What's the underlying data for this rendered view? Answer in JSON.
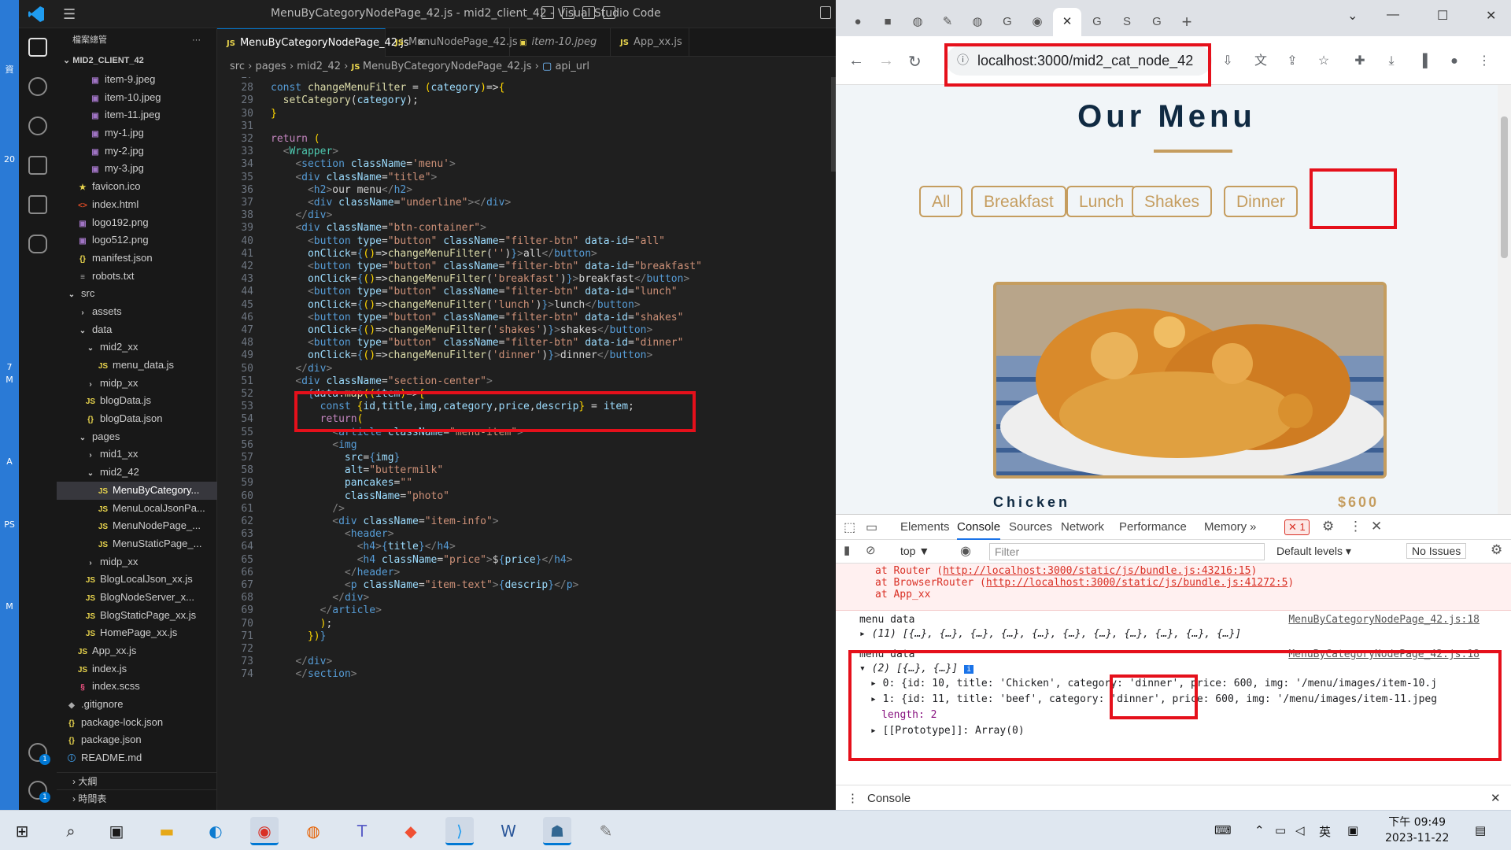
{
  "desktop": {
    "labels": [
      "資",
      "20",
      "7",
      "M",
      "A",
      "PS",
      "M"
    ]
  },
  "vscode": {
    "window_title": "MenuByCategoryNodePage_42.js - mid2_client_42 - Visual Studio Code",
    "explorer_header": "檔案總管",
    "project": "MID2_CLIENT_42",
    "badges": {
      "accounts": "1",
      "settings": "1"
    },
    "tree": [
      {
        "label": "item-9.jpeg",
        "icon": "img",
        "indent": 40
      },
      {
        "label": "item-10.jpeg",
        "icon": "img",
        "indent": 40
      },
      {
        "label": "item-11.jpeg",
        "icon": "img",
        "indent": 40
      },
      {
        "label": "my-1.jpg",
        "icon": "img",
        "indent": 40
      },
      {
        "label": "my-2.jpg",
        "icon": "img",
        "indent": 40
      },
      {
        "label": "my-3.jpg",
        "icon": "img",
        "indent": 40
      },
      {
        "label": "favicon.ico",
        "icon": "ico",
        "indent": 24
      },
      {
        "label": "index.html",
        "icon": "html",
        "indent": 24
      },
      {
        "label": "logo192.png",
        "icon": "img",
        "indent": 24
      },
      {
        "label": "logo512.png",
        "icon": "img",
        "indent": 24
      },
      {
        "label": "manifest.json",
        "icon": "json",
        "indent": 24
      },
      {
        "label": "robots.txt",
        "icon": "txt",
        "indent": 24
      },
      {
        "label": "src",
        "icon": "fold-open",
        "indent": 10
      },
      {
        "label": "assets",
        "icon": "fold",
        "indent": 24
      },
      {
        "label": "data",
        "icon": "fold-open",
        "indent": 24
      },
      {
        "label": "mid2_xx",
        "icon": "fold-open",
        "indent": 34
      },
      {
        "label": "menu_data.js",
        "icon": "js",
        "indent": 50
      },
      {
        "label": "midp_xx",
        "icon": "fold",
        "indent": 34
      },
      {
        "label": "blogData.js",
        "icon": "js",
        "indent": 34
      },
      {
        "label": "blogData.json",
        "icon": "json",
        "indent": 34
      },
      {
        "label": "pages",
        "icon": "fold-open",
        "indent": 24
      },
      {
        "label": "mid1_xx",
        "icon": "fold",
        "indent": 34
      },
      {
        "label": "mid2_42",
        "icon": "fold-open",
        "indent": 34
      },
      {
        "label": "MenuByCategory...",
        "icon": "js",
        "indent": 50,
        "selected": true
      },
      {
        "label": "MenuLocalJsonPa...",
        "icon": "js",
        "indent": 50
      },
      {
        "label": "MenuNodePage_...",
        "icon": "js",
        "indent": 50
      },
      {
        "label": "MenuStaticPage_...",
        "icon": "js",
        "indent": 50
      },
      {
        "label": "midp_xx",
        "icon": "fold",
        "indent": 34
      },
      {
        "label": "BlogLocalJson_xx.js",
        "icon": "js",
        "indent": 34
      },
      {
        "label": "BlogNodeServer_x...",
        "icon": "js",
        "indent": 34
      },
      {
        "label": "BlogStaticPage_xx.js",
        "icon": "js",
        "indent": 34
      },
      {
        "label": "HomePage_xx.js",
        "icon": "js",
        "indent": 34
      },
      {
        "label": "App_xx.js",
        "icon": "js",
        "indent": 24
      },
      {
        "label": "index.js",
        "icon": "js",
        "indent": 24
      },
      {
        "label": "index.scss",
        "icon": "css",
        "indent": 24
      },
      {
        "label": ".gitignore",
        "icon": "git",
        "indent": 10
      },
      {
        "label": "package-lock.json",
        "icon": "json",
        "indent": 10
      },
      {
        "label": "package.json",
        "icon": "json",
        "indent": 10
      },
      {
        "label": "README.md",
        "icon": "md",
        "indent": 10
      }
    ],
    "outline": "大綱",
    "timeline": "時間表",
    "tabs": [
      {
        "label": "MenuByCategoryNodePage_42.js",
        "active": true,
        "kind": "JS"
      },
      {
        "label": "MenuNodePage_42.js",
        "active": false,
        "kind": "JS"
      },
      {
        "label": "item-10.jpeg",
        "active": false,
        "kind": "img"
      },
      {
        "label": "App_xx.js",
        "active": false,
        "kind": "JS"
      }
    ],
    "breadcrumb": [
      "src",
      "pages",
      "mid2_42",
      "MenuByCategoryNodePage_42.js",
      "api_url"
    ],
    "code_lines": [
      {
        "n": "27",
        "html": ""
      },
      {
        "n": "28",
        "html": "<span class='k'>const</span> <span class='f'>changeMenuFilter</span> = <span class='br'>(</span><span class='a'>category</span><span class='br'>)</span>=><span class='br'>{</span>"
      },
      {
        "n": "29",
        "html": "  <span class='f'>setCategory</span>(<span class='a'>category</span>);"
      },
      {
        "n": "30",
        "html": "<span class='br'>}</span>"
      },
      {
        "n": "31",
        "html": ""
      },
      {
        "n": "32",
        "html": "<span class='kw'>return</span> <span class='br'>(</span>"
      },
      {
        "n": "33",
        "html": "  <span class='tg'>&lt;</span><span class='t'>Wrapper</span><span class='tg'>&gt;</span>"
      },
      {
        "n": "34",
        "html": "    <span class='tg'>&lt;</span><span class='tn'>section</span> <span class='a'>className</span>=<span class='s'>'menu'</span><span class='tg'>&gt;</span>"
      },
      {
        "n": "35",
        "html": "    <span class='tg'>&lt;</span><span class='tn'>div</span> <span class='a'>className</span>=<span class='s'>\"title\"</span><span class='tg'>&gt;</span>"
      },
      {
        "n": "36",
        "html": "      <span class='tg'>&lt;</span><span class='tn'>h2</span><span class='tg'>&gt;</span>our menu<span class='tg'>&lt;/</span><span class='tn'>h2</span><span class='tg'>&gt;</span>"
      },
      {
        "n": "37",
        "html": "      <span class='tg'>&lt;</span><span class='tn'>div</span> <span class='a'>className</span>=<span class='s'>\"underline\"</span><span class='tg'>&gt;&lt;/</span><span class='tn'>div</span><span class='tg'>&gt;</span>"
      },
      {
        "n": "38",
        "html": "    <span class='tg'>&lt;/</span><span class='tn'>div</span><span class='tg'>&gt;</span>"
      },
      {
        "n": "39",
        "html": "    <span class='tg'>&lt;</span><span class='tn'>div</span> <span class='a'>className</span>=<span class='s'>\"btn-container\"</span><span class='tg'>&gt;</span>"
      },
      {
        "n": "40",
        "html": "      <span class='tg'>&lt;</span><span class='tn'>button</span> <span class='a'>type</span>=<span class='s'>\"button\"</span> <span class='a'>className</span>=<span class='s'>\"filter-btn\"</span> <span class='a'>data-id</span>=<span class='s'>\"all\"</span>"
      },
      {
        "n": "41",
        "html": "      <span class='a'>onClick</span>=<span class='k'>{</span><span class='br'>()</span>=><span class='f'>changeMenuFilter</span>(<span class='s'>''</span>)<span class='k'>}</span><span class='tg'>&gt;</span>all<span class='tg'>&lt;/</span><span class='tn'>button</span><span class='tg'>&gt;</span>"
      },
      {
        "n": "42",
        "html": "      <span class='tg'>&lt;</span><span class='tn'>button</span> <span class='a'>type</span>=<span class='s'>\"button\"</span> <span class='a'>className</span>=<span class='s'>\"filter-btn\"</span> <span class='a'>data-id</span>=<span class='s'>\"breakfast\"</span>"
      },
      {
        "n": "43",
        "html": "      <span class='a'>onClick</span>=<span class='k'>{</span><span class='br'>()</span>=><span class='f'>changeMenuFilter</span>(<span class='s'>'breakfast'</span>)<span class='k'>}</span><span class='tg'>&gt;</span>breakfast<span class='tg'>&lt;/</span><span class='tn'>button</span><span class='tg'>&gt;</span>"
      },
      {
        "n": "44",
        "html": "      <span class='tg'>&lt;</span><span class='tn'>button</span> <span class='a'>type</span>=<span class='s'>\"button\"</span> <span class='a'>className</span>=<span class='s'>\"filter-btn\"</span> <span class='a'>data-id</span>=<span class='s'>\"lunch\"</span>"
      },
      {
        "n": "45",
        "html": "      <span class='a'>onClick</span>=<span class='k'>{</span><span class='br'>()</span>=><span class='f'>changeMenuFilter</span>(<span class='s'>'lunch'</span>)<span class='k'>}</span><span class='tg'>&gt;</span>lunch<span class='tg'>&lt;/</span><span class='tn'>button</span><span class='tg'>&gt;</span>"
      },
      {
        "n": "46",
        "html": "      <span class='tg'>&lt;</span><span class='tn'>button</span> <span class='a'>type</span>=<span class='s'>\"button\"</span> <span class='a'>className</span>=<span class='s'>\"filter-btn\"</span> <span class='a'>data-id</span>=<span class='s'>\"shakes\"</span>"
      },
      {
        "n": "47",
        "html": "      <span class='a'>onClick</span>=<span class='k'>{</span><span class='br'>()</span>=><span class='f'>changeMenuFilter</span>(<span class='s'>'shakes'</span>)<span class='k'>}</span><span class='tg'>&gt;</span>shakes<span class='tg'>&lt;/</span><span class='tn'>button</span><span class='tg'>&gt;</span>"
      },
      {
        "n": "48",
        "html": "      <span class='tg'>&lt;</span><span class='tn'>button</span> <span class='a'>type</span>=<span class='s'>\"button\"</span> <span class='a'>className</span>=<span class='s'>\"filter-btn\"</span> <span class='a'>data-id</span>=<span class='s'>\"dinner\"</span>"
      },
      {
        "n": "49",
        "html": "      <span class='a'>onClick</span>=<span class='k'>{</span><span class='br'>()</span>=><span class='f'>changeMenuFilter</span>(<span class='s'>'dinner'</span>)<span class='k'>}</span><span class='tg'>&gt;</span>dinner<span class='tg'>&lt;/</span><span class='tn'>button</span><span class='tg'>&gt;</span>"
      },
      {
        "n": "50",
        "html": "    <span class='tg'>&lt;/</span><span class='tn'>div</span><span class='tg'>&gt;</span>"
      },
      {
        "n": "51",
        "html": "    <span class='tg'>&lt;</span><span class='tn'>div</span> <span class='a'>className</span>=<span class='s'>\"section-center\"</span><span class='tg'>&gt;</span>"
      },
      {
        "n": "52",
        "html": "      <span class='k'>{</span><span class='v'>data</span>.<span class='f'>map</span><span class='br'>((</span><span class='a'>item</span><span class='br'>)</span>=><span class='br'>{</span>"
      },
      {
        "n": "53",
        "html": "        <span class='k'>const</span> <span class='br'>{</span><span class='v'>id</span>,<span class='v'>title</span>,<span class='v'>img</span>,<span class='v'>category</span>,<span class='v'>price</span>,<span class='v'>descrip</span><span class='br'>}</span> = <span class='v'>item</span>;"
      },
      {
        "n": "54",
        "html": "        <span class='kw'>return</span><span class='br'>(</span>"
      },
      {
        "n": "55",
        "html": "          <span class='tg'>&lt;</span><span class='tn'>article</span> <span class='a'>className</span>=<span class='s'>\"menu-item\"</span><span class='tg'>&gt;</span>"
      },
      {
        "n": "56",
        "html": "          <span class='tg'>&lt;</span><span class='tn'>img</span>"
      },
      {
        "n": "57",
        "html": "            <span class='a'>src</span>=<span class='k'>{</span><span class='v'>img</span><span class='k'>}</span>"
      },
      {
        "n": "58",
        "html": "            <span class='a'>alt</span>=<span class='s'>\"buttermilk\"</span>"
      },
      {
        "n": "59",
        "html": "            <span class='a'>pancakes</span>=<span class='s'>\"\"</span>"
      },
      {
        "n": "60",
        "html": "            <span class='a'>className</span>=<span class='s'>\"photo\"</span>"
      },
      {
        "n": "61",
        "html": "          <span class='tg'>/&gt;</span>"
      },
      {
        "n": "62",
        "html": "          <span class='tg'>&lt;</span><span class='tn'>div</span> <span class='a'>className</span>=<span class='s'>\"item-info\"</span><span class='tg'>&gt;</span>"
      },
      {
        "n": "63",
        "html": "            <span class='tg'>&lt;</span><span class='tn'>header</span><span class='tg'>&gt;</span>"
      },
      {
        "n": "64",
        "html": "              <span class='tg'>&lt;</span><span class='tn'>h4</span><span class='tg'>&gt;</span><span class='k'>{</span><span class='v'>title</span><span class='k'>}</span><span class='tg'>&lt;/</span><span class='tn'>h4</span><span class='tg'>&gt;</span>"
      },
      {
        "n": "65",
        "html": "              <span class='tg'>&lt;</span><span class='tn'>h4</span> <span class='a'>className</span>=<span class='s'>\"price\"</span><span class='tg'>&gt;</span>$<span class='k'>{</span><span class='v'>price</span><span class='k'>}</span><span class='tg'>&lt;/</span><span class='tn'>h4</span><span class='tg'>&gt;</span>"
      },
      {
        "n": "66",
        "html": "            <span class='tg'>&lt;/</span><span class='tn'>header</span><span class='tg'>&gt;</span>"
      },
      {
        "n": "67",
        "html": "            <span class='tg'>&lt;</span><span class='tn'>p</span> <span class='a'>className</span>=<span class='s'>\"item-text\"</span><span class='tg'>&gt;</span><span class='k'>{</span><span class='v'>descrip</span><span class='k'>}</span><span class='tg'>&lt;/</span><span class='tn'>p</span><span class='tg'>&gt;</span>"
      },
      {
        "n": "68",
        "html": "          <span class='tg'>&lt;/</span><span class='tn'>div</span><span class='tg'>&gt;</span>"
      },
      {
        "n": "69",
        "html": "        <span class='tg'>&lt;/</span><span class='tn'>article</span><span class='tg'>&gt;</span>"
      },
      {
        "n": "70",
        "html": "        <span class='br'>)</span>;"
      },
      {
        "n": "71",
        "html": "      <span class='br'>})</span><span class='k'>}</span>"
      },
      {
        "n": "72",
        "html": ""
      },
      {
        "n": "73",
        "html": "    <span class='tg'>&lt;/</span><span class='tn'>div</span><span class='tg'>&gt;</span>"
      },
      {
        "n": "74",
        "html": "    <span class='tg'>&lt;/</span><span class='tn'>section</span><span class='tg'>&gt;</span>"
      }
    ]
  },
  "browser": {
    "url": "localhost:3000/mid2_cat_node_42",
    "page": {
      "title": "Our Menu",
      "filters": [
        "All",
        "Breakfast",
        "Lunch",
        "Shakes",
        "Dinner"
      ],
      "item": {
        "title": "Chicken",
        "price": "$600"
      }
    },
    "devtools": {
      "tabs": [
        "Elements",
        "Console",
        "Sources",
        "Network",
        "Performance",
        "Memory"
      ],
      "more": "»",
      "error_count": "1",
      "context": "top",
      "filter_placeholder": "Filter",
      "levels": "Default levels",
      "issues": "No Issues",
      "error_lines": [
        {
          "pre": "at Router (",
          "link": "http://localhost:3000/static/js/bundle.js:43216:15",
          "post": ")"
        },
        {
          "pre": "at BrowserRouter (",
          "link": "http://localhost:3000/static/js/bundle.js:41272:5",
          "post": ")"
        },
        {
          "pre": "at App_xx",
          "link": "",
          "post": ""
        }
      ],
      "log1": {
        "label": "menu data",
        "source": "MenuByCategoryNodePage_42.js:18",
        "summary": "(11) [{…}, {…}, {…}, {…}, {…}, {…}, {…}, {…}, {…}, {…}, {…}]"
      },
      "log2": {
        "label": "menu data",
        "source": "MenuByCategoryNodePage_42.js:18",
        "summary": "(2) [{…}, {…}]",
        "row0": "0: {id: 10, title: 'Chicken', category: 'dinner', price: 600, img: '/menu/images/item-10.j",
        "row1": "1: {id: 11, title: 'beef', category: 'dinner', price: 600, img: '/menu/images/item-11.jpeg",
        "len": "length: 2",
        "proto": "[[Prototype]]: Array(0)"
      },
      "drawer": "Console"
    }
  },
  "taskbar": {
    "time": "下午 09:49",
    "date": "2023-11-22",
    "ime": "英"
  }
}
